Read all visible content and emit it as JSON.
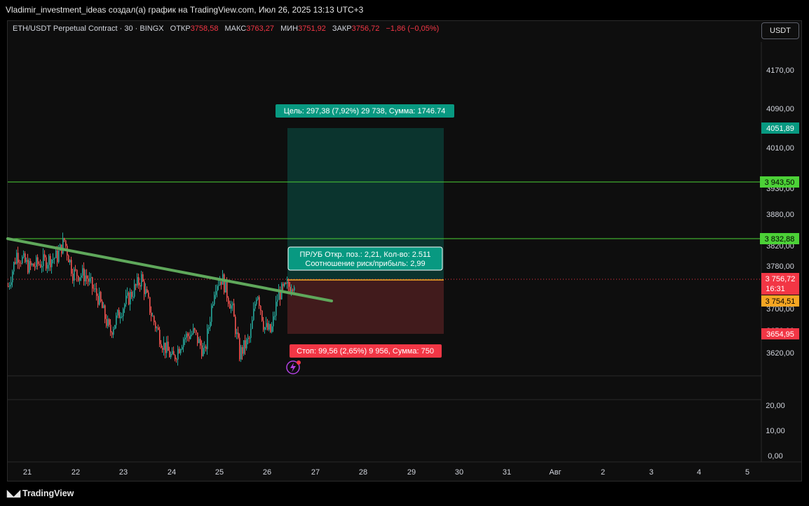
{
  "credit": "Vladimir_investment_ideas создал(а) график на TradingView.com, Июл 26, 2025 13:13 UTC+3",
  "header": {
    "symbol": "ETH/USDT Perpetual Contract · 30 · BINGX",
    "open_label": "ОТКР",
    "open": "3758,58",
    "high_label": "МАКС",
    "high": "3763,27",
    "low_label": "МИН",
    "low": "3751,92",
    "close_label": "ЗАКР",
    "close": "3756,72",
    "change": "−1,86 (−0,05%)"
  },
  "currency_button": "USDT",
  "brand": "TradingView",
  "colors": {
    "background": "#0e0e0e",
    "up": "#26a69a",
    "down": "#ef5350",
    "resistance": "#4cd137",
    "trendline": "#5fa85b",
    "target_label": "#089981",
    "stop_label": "#f23645",
    "position_line": "#f5a623"
  },
  "chart_data": {
    "type": "candlestick",
    "title": "ETH/USDT Perpetual Contract · 30 · BINGX",
    "x_ticks": [
      "21",
      "22",
      "23",
      "24",
      "25",
      "26",
      "27",
      "28",
      "29",
      "30",
      "31",
      "Авг",
      "2",
      "3",
      "4",
      "5"
    ],
    "y_ticks": [
      "4170,00",
      "4090,00",
      "4010,00",
      "3930,00",
      "3880,00",
      "3820,00",
      "3780,00",
      "3700,00",
      "3650,00",
      "3620,00"
    ],
    "ylim": [
      3590,
      4230
    ],
    "candles_approx": {
      "x": [
        "21",
        "21.5",
        "22",
        "22.5",
        "23",
        "23.5",
        "24",
        "24.5",
        "25",
        "25.5",
        "26",
        "26.4"
      ],
      "close": [
        3760,
        3825,
        3755,
        3700,
        3770,
        3660,
        3640,
        3700,
        3690,
        3650,
        3730,
        3757
      ]
    },
    "horizontal_lines": [
      {
        "price": 3943.5,
        "label": "3 943,50"
      },
      {
        "price": 3832.88,
        "label": "3 832,88"
      }
    ],
    "trendline": {
      "start": {
        "x": "20.5",
        "price": 3828
      },
      "end": {
        "x": "27.3",
        "price": 3715
      }
    },
    "position": {
      "entry": 3754.51,
      "target": 4051.89,
      "stop": 3654.95,
      "target_text": "Цель: 297,38 (7,92%) 29 738, Сумма: 1746.74",
      "info_text_1": "ПР/УБ Откр. поз.: 2,21, Кол-во: 2.511",
      "info_text_2": "Соотношение риск/прибыль: 2,99",
      "stop_text": "Стоп: 99,56 (2,65%) 9 956, Сумма: 750"
    },
    "price_labels": {
      "target": "4051,89",
      "last": "3 756,72",
      "countdown": "16:31",
      "entry": "3 754,51",
      "stop": "3654,95"
    },
    "volume_axis": {
      "ticks": [
        "20,00",
        "10,00",
        "0,00"
      ]
    }
  }
}
